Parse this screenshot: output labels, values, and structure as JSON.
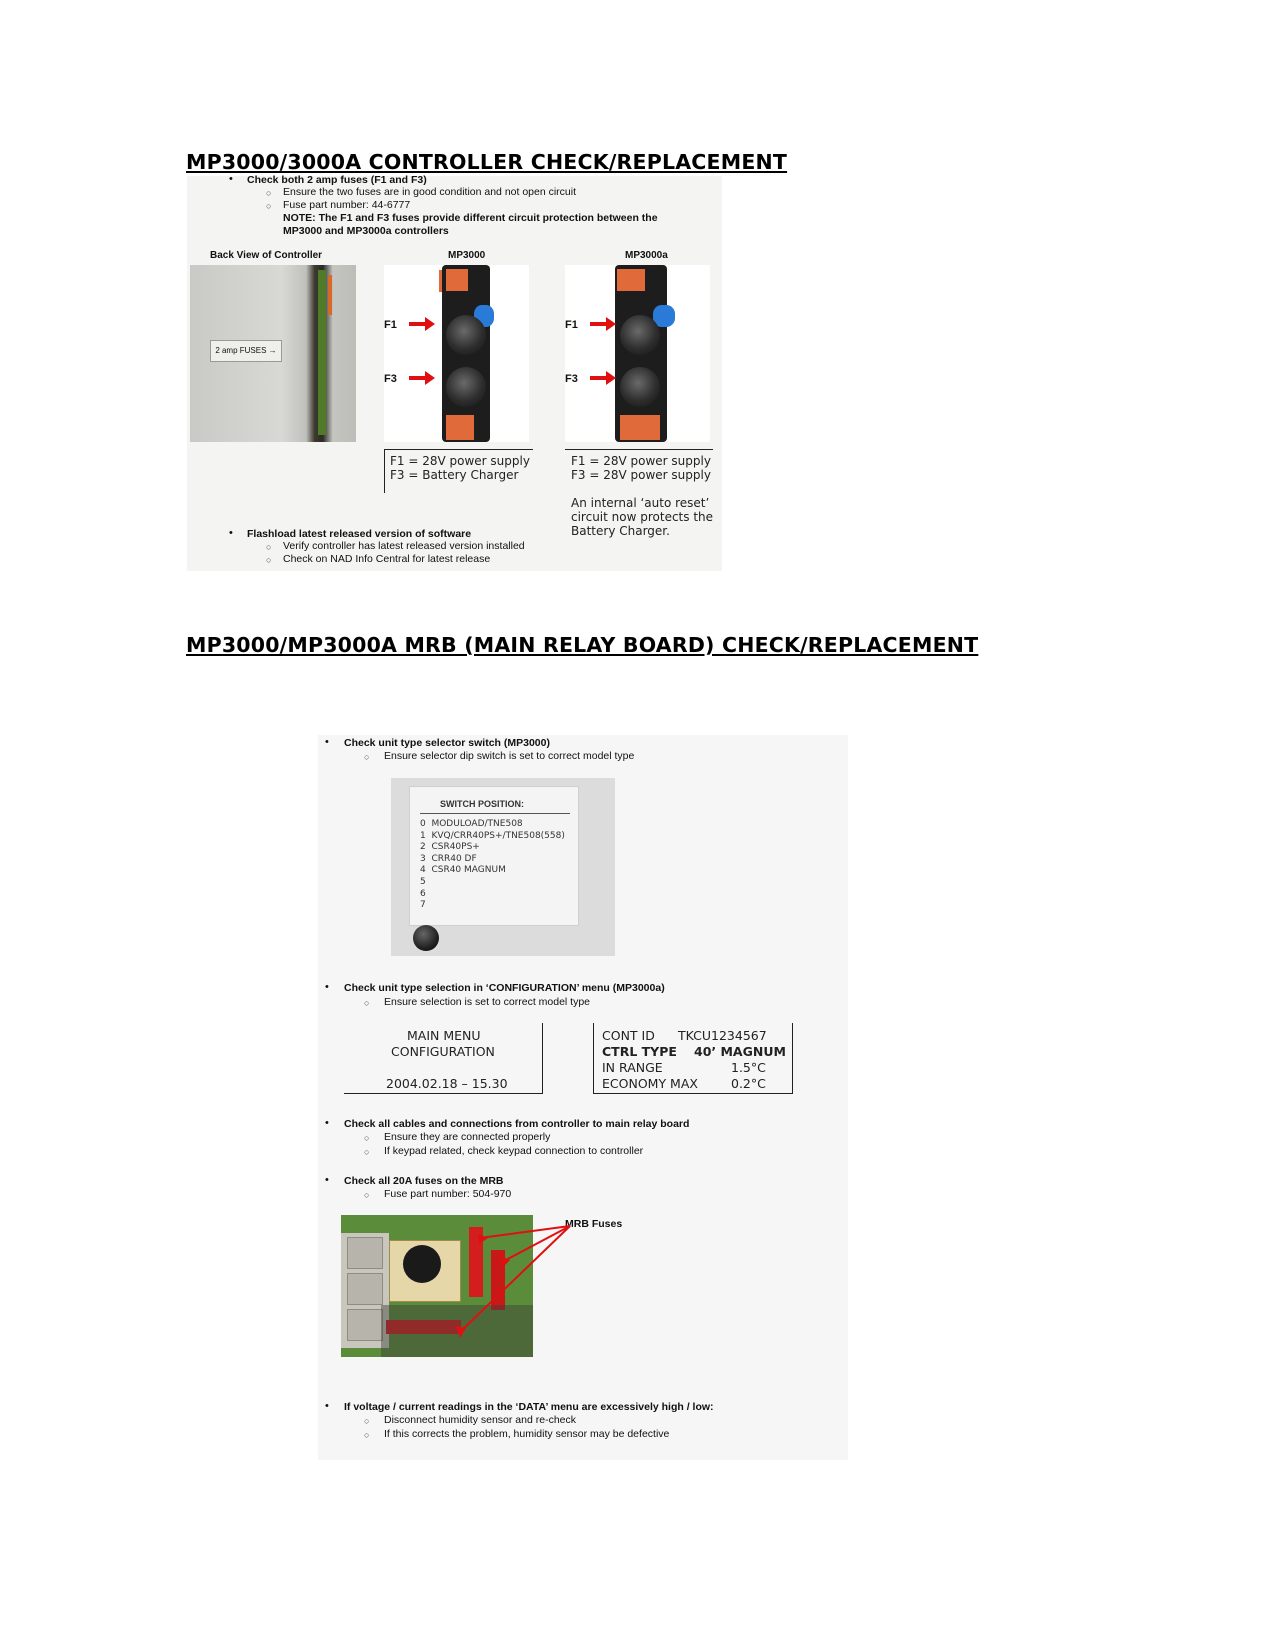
{
  "section1": {
    "title": "MP3000/3000A CONTROLLER CHECK/REPLACEMENT",
    "bullet1": "Check both 2 amp fuses (F1 and F3)",
    "bullet1_sub1": "Ensure the two fuses are in good condition and not open circuit",
    "bullet1_sub2": "Fuse part number: 44-6777",
    "note_line1": "NOTE: The F1 and F3 fuses provide different circuit protection between the",
    "note_line2": "MP3000 and MP3000a controllers",
    "caption_back": "Back View of Controller",
    "caption_mp3000": "MP3000",
    "caption_mp3000a": "MP3000a",
    "back_label": "2 amp FUSES",
    "f1": "F1",
    "f3": "F3",
    "mp3000_f1": "F1 = 28V power supply",
    "mp3000_f3": "F3 = Battery Charger",
    "mp3000a_f1": "F1 = 28V power supply",
    "mp3000a_f3": "F3 = 28V power supply",
    "mp3000a_note1": "An internal ‘auto reset’",
    "mp3000a_note2": "circuit now protects the",
    "mp3000a_note3": "Battery Charger.",
    "bullet2": "Flashload latest released version of software",
    "bullet2_sub1": "Verify controller has latest released version installed",
    "bullet2_sub2": "Check on NAD Info Central for latest release"
  },
  "section2": {
    "title": "MP3000/MP3000A MRB (MAIN RELAY BOARD) CHECK/REPLACEMENT",
    "bullet1": "Check unit type selector switch (MP3000)",
    "bullet1_sub1": "Ensure selector dip switch is set to correct model type",
    "switch_header": "SWITCH POSITION:",
    "switch_lines": "0  MODULOAD/TNE508\n1  KVQ/CRR40PS+/TNE508(558)\n2  CSR40PS+\n3  CRR40 DF\n4  CSR40 MAGNUM\n5\n6\n7",
    "bullet2": "Check unit type selection in ‘CONFIGURATION’ menu (MP3000a)",
    "bullet2_sub1": "Ensure selection is set to correct model type",
    "menu_line1": "MAIN MENU",
    "menu_line2": "CONFIGURATION",
    "menu_line3": "2004.02.18 – 15.30",
    "cfg_contid_label": "CONT ID",
    "cfg_contid_value": "TKCU1234567",
    "cfg_ctrltype_label": "CTRL TYPE",
    "cfg_ctrltype_value": "40’ MAGNUM",
    "cfg_inrange_label": "IN RANGE",
    "cfg_inrange_value": "1.5°C",
    "cfg_economy_label": "ECONOMY MAX",
    "cfg_economy_value": "0.2°C",
    "bullet3": "Check all cables and connections from controller to main relay board",
    "bullet3_sub1": "Ensure they are connected properly",
    "bullet3_sub2": "If keypad related, check keypad connection to controller",
    "bullet4": "Check all 20A fuses on the MRB",
    "bullet4_sub1": "Fuse part number: 504-970",
    "mrb_fuses_label": "MRB Fuses",
    "bullet5": "If voltage / current readings in the ‘DATA’ menu are excessively high / low:",
    "bullet5_sub1": "Disconnect humidity sensor and re-check",
    "bullet5_sub2": "If this corrects the problem, humidity sensor may be defective"
  },
  "colors": {
    "arrow_red": "#e01010",
    "connector_orange": "#e06a3a",
    "blue_cap": "#2a7ad8"
  }
}
